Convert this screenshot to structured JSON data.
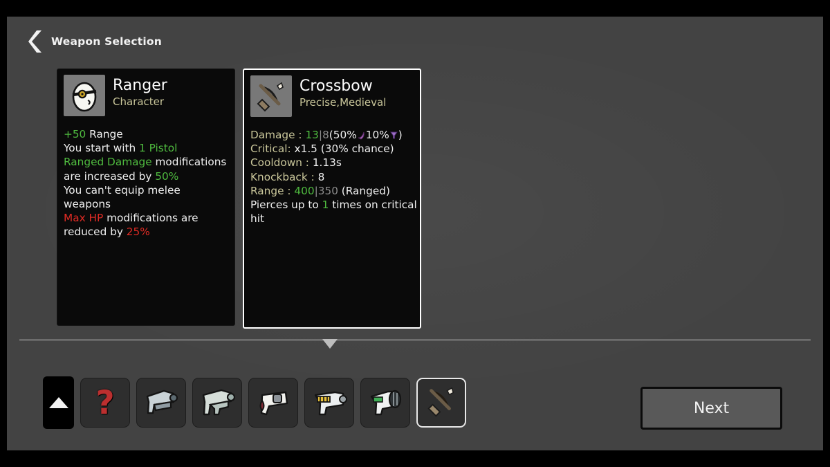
{
  "header": {
    "back_icon": "chevron-left-icon",
    "title": "Weapon Selection"
  },
  "cards": [
    {
      "id": "character-card",
      "icon": "ranger-egg-portrait-icon",
      "title": "Ranger",
      "subtitle": "Character",
      "selected": false,
      "lines": [
        {
          "parts": [
            {
              "t": "+50",
              "c": "green"
            },
            {
              "t": " Range",
              "c": "white"
            }
          ]
        },
        {
          "parts": [
            {
              "t": "You start with ",
              "c": "white"
            },
            {
              "t": "1 Pistol",
              "c": "green"
            }
          ]
        },
        {
          "parts": [
            {
              "t": "Ranged Damage",
              "c": "green"
            },
            {
              "t": " modifications",
              "c": "white"
            }
          ]
        },
        {
          "parts": [
            {
              "t": "are increased by ",
              "c": "white"
            },
            {
              "t": "50%",
              "c": "green"
            }
          ]
        },
        {
          "parts": [
            {
              "t": "You can't equip melee",
              "c": "white"
            }
          ]
        },
        {
          "parts": [
            {
              "t": "weapons",
              "c": "white"
            }
          ]
        },
        {
          "parts": [
            {
              "t": "Max HP",
              "c": "red"
            },
            {
              "t": " modifications are",
              "c": "white"
            }
          ]
        },
        {
          "parts": [
            {
              "t": "reduced by ",
              "c": "white"
            },
            {
              "t": "25%",
              "c": "red"
            }
          ]
        }
      ]
    },
    {
      "id": "weapon-card",
      "icon": "crossbow-icon",
      "title": "Crossbow",
      "subtitle": "Precise,Medieval",
      "selected": true,
      "lines": [
        {
          "parts": [
            {
              "t": "Damage : ",
              "c": "gold"
            },
            {
              "t": "13",
              "c": "green"
            },
            {
              "t": "|",
              "c": "gray"
            },
            {
              "t": "8",
              "c": "gray"
            },
            {
              "t": "(50%",
              "c": "white"
            },
            {
              "t": "melee-stat-icon",
              "c": "icon-melee"
            },
            {
              "t": "10%",
              "c": "white"
            },
            {
              "t": "ranged-stat-icon",
              "c": "icon-ranged"
            },
            {
              "t": ")",
              "c": "white"
            }
          ]
        },
        {
          "parts": [
            {
              "t": "Critical: ",
              "c": "gold"
            },
            {
              "t": "x1.5 (30% chance)",
              "c": "white"
            }
          ]
        },
        {
          "parts": [
            {
              "t": "Cooldown : ",
              "c": "gold"
            },
            {
              "t": "1.13s",
              "c": "white"
            }
          ]
        },
        {
          "parts": [
            {
              "t": "Knockback : ",
              "c": "gold"
            },
            {
              "t": "8",
              "c": "white"
            }
          ]
        },
        {
          "parts": [
            {
              "t": "Range : ",
              "c": "gold"
            },
            {
              "t": "400",
              "c": "green"
            },
            {
              "t": "|",
              "c": "gray"
            },
            {
              "t": "350",
              "c": "gray"
            },
            {
              "t": " (Ranged)",
              "c": "white"
            }
          ]
        },
        {
          "parts": [
            {
              "t": "Pierces up to ",
              "c": "white"
            },
            {
              "t": "1",
              "c": "green"
            },
            {
              "t": " times on critical",
              "c": "white"
            }
          ]
        },
        {
          "parts": [
            {
              "t": "hit",
              "c": "white"
            }
          ]
        }
      ]
    }
  ],
  "divider": {
    "arrow_icon": "triangle-down-icon"
  },
  "slots": [
    {
      "id": "scroll-up",
      "icon": "triangle-up-icon",
      "kind": "scroll",
      "selected": false
    },
    {
      "id": "unknown-weapon",
      "icon": "question-mark-icon",
      "kind": "unknown",
      "selected": false
    },
    {
      "id": "weapon-1",
      "icon": "pistol-grey-icon",
      "kind": "weapon",
      "selected": false
    },
    {
      "id": "weapon-2",
      "icon": "pistol-teal-icon",
      "kind": "weapon",
      "selected": false
    },
    {
      "id": "weapon-3",
      "icon": "revolver-icon",
      "kind": "weapon",
      "selected": false
    },
    {
      "id": "weapon-4",
      "icon": "smg-yellow-icon",
      "kind": "weapon",
      "selected": false
    },
    {
      "id": "weapon-5",
      "icon": "shotgun-green-icon",
      "kind": "weapon",
      "selected": false
    },
    {
      "id": "weapon-6",
      "icon": "crossbow-icon",
      "kind": "weapon",
      "selected": true
    }
  ],
  "next_button": {
    "label": "Next"
  },
  "colors": {
    "background": "#434343",
    "card_background": "#0a0a0a",
    "selected_border": "#ffffff",
    "accent_green": "#4fbb3f",
    "accent_gold": "#c9c69a",
    "accent_red": "#e02b24",
    "muted_gray": "#8d8d8d",
    "letterbox": "#000000"
  }
}
